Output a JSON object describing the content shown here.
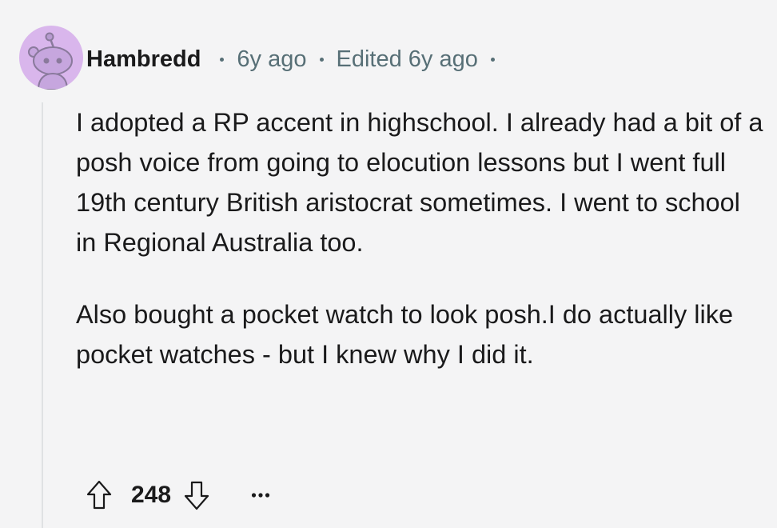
{
  "comment": {
    "author": "Hambredd",
    "posted": "6y ago",
    "edited": "Edited 6y ago",
    "paragraphs": [
      "I adopted a RP accent in highschool. I already had a bit of a posh voice from going to elocution lessons but I went full 19th century British aristocrat sometimes. I went to school in Regional Australia too.",
      "Also bought a pocket watch to look posh.I do actually like pocket watches - but I knew why I did it."
    ],
    "score": "248"
  },
  "icons": {
    "avatar": "reddit-snoo-avatar-icon",
    "upvote": "arrow-up-outline-icon",
    "downvote": "arrow-down-outline-icon",
    "more": "ellipsis-icon"
  },
  "colors": {
    "background": "#f4f4f5",
    "avatar_bg": "#d9b6ec",
    "meta_text": "#576f76",
    "body_text": "#1a1a1b",
    "thread_line": "#dfe1e3"
  }
}
